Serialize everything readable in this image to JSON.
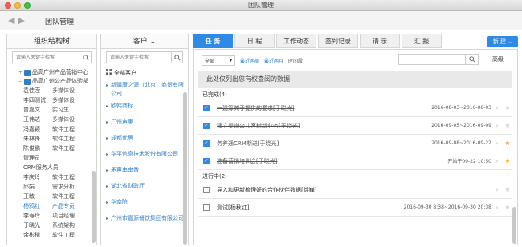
{
  "window": {
    "title": "团队管理"
  },
  "header": {
    "title": "团队管理"
  },
  "org": {
    "title": "组织结构树",
    "search_placeholder": "请输入关键字检索",
    "nodes": [
      {
        "toggle": "+",
        "label": "品高广州产品营销中心"
      },
      {
        "toggle": "−",
        "label": "品高广州公产品体验部"
      }
    ],
    "members": [
      {
        "name": "袁佳滢",
        "role": "多媒体设"
      },
      {
        "name": "李四测试",
        "role": "多媒体设"
      },
      {
        "name": "曾嘉文",
        "role": "实习生"
      },
      {
        "name": "王伟达",
        "role": "多媒体设"
      },
      {
        "name": "冯嘉颖",
        "role": "软件工程"
      },
      {
        "name": "朱林锋",
        "role": "软件工程"
      },
      {
        "name": "陈俊鹏",
        "role": "软件工程"
      },
      {
        "name": "管理员",
        "role": ""
      },
      {
        "name": "CRM服务人员",
        "role": ""
      },
      {
        "name": "李庆玲",
        "role": "软件工程"
      },
      {
        "name": "邱娟",
        "role": "需求分析"
      },
      {
        "name": "王敏",
        "role": "软件工程"
      },
      {
        "name": "杨鸦红",
        "role": "产品专员",
        "selected": true
      },
      {
        "name": "李寿玲",
        "role": "项目经理"
      },
      {
        "name": "于晓光",
        "role": "系统架构"
      },
      {
        "name": "余彬楷",
        "role": "软件工程"
      }
    ]
  },
  "customers": {
    "title": "客户 ⌄",
    "search_placeholder": "请输入关键字检索",
    "all_label": "全部客户",
    "items": [
      "新疆康之源（北京）商贸有限公司",
      "欧韩商标",
      "广州声美",
      "成都优居",
      "华平信息技术股份有限公司",
      "矛声串串香",
      "湖北省财政厅",
      "华南院",
      "广州市嘉源餐饮集团有限公司"
    ]
  },
  "tabs": [
    "任 务",
    "日 程",
    "工作动态",
    "签到记录",
    "请 示",
    "汇 报"
  ],
  "new_button": "新 建 ⌄",
  "filter": {
    "scope": "全部",
    "options": [
      "最近两周",
      "最近两月",
      "时间段"
    ],
    "advanced": "高级"
  },
  "notice": "此处仅列出您有权查阅的数据",
  "groups": {
    "done": "已完成(4)",
    "doing": "进行中(2)"
  },
  "tasks": [
    {
      "title": "一建筹关于提供的要求[手晓光]",
      "date": "2016-08-03~2016-08-03",
      "done": true,
      "starred": false
    },
    {
      "title": "建立渠道公共客树新业务[于晓光]",
      "date": "2016-09-05~2016-09-09",
      "done": true,
      "starred": false
    },
    {
      "title": "务养通CRM期进[于晓光]",
      "date": "2016-09-08~2016-09-22",
      "done": true,
      "starred": true
    },
    {
      "title": "准备营销培训会[手晓光]",
      "date": "开始于09-22 10:50",
      "done": true,
      "starred": true
    },
    {
      "title": "导入和更新梳理好的合作伙伴数据[徐巍]",
      "date": "",
      "done": false,
      "starred": false
    },
    {
      "title": "测试[杨秋红]",
      "date": "2016-09-30 8:38~2016-09-30 20:38",
      "done": false,
      "starred": false
    }
  ]
}
